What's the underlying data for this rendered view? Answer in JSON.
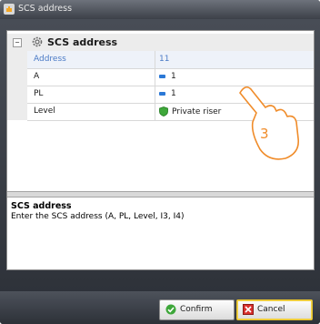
{
  "window": {
    "title": "SCS address"
  },
  "group": {
    "title": "SCS address",
    "collapse_symbol": "−"
  },
  "properties": [
    {
      "name": "Address",
      "value": "11"
    },
    {
      "name": "A",
      "value": "1"
    },
    {
      "name": "PL",
      "value": "1"
    },
    {
      "name": "Level",
      "value": "Private riser"
    }
  ],
  "description": {
    "title": "SCS address",
    "text": "Enter the SCS address (A, PL, Level, I3, I4)"
  },
  "buttons": {
    "confirm": "Confirm",
    "cancel": "Cancel"
  },
  "annotation": {
    "number": "3"
  },
  "colors": {
    "accent": "#4b7bc6",
    "annotation": "#f08c2a",
    "cancel_focus": "#e8c32c"
  }
}
